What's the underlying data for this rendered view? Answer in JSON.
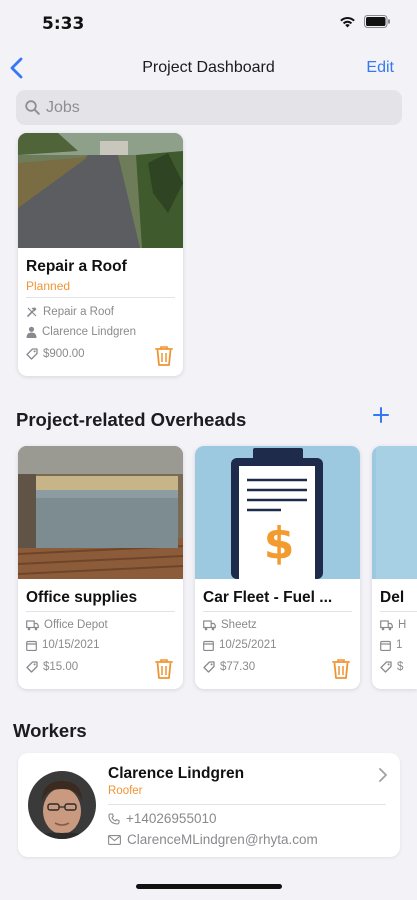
{
  "status_bar": {
    "time": "5:33"
  },
  "nav": {
    "title": "Project Dashboard",
    "edit_label": "Edit"
  },
  "search": {
    "placeholder": "Jobs"
  },
  "jobs": [
    {
      "title": "Repair a Roof",
      "status": "Planned",
      "task": "Repair a Roof",
      "worker": "Clarence  Lindgren",
      "amount": "$900.00"
    }
  ],
  "overheads_section": {
    "title": "Project-related Overheads"
  },
  "overheads": [
    {
      "title": "Office supplies",
      "vendor": "Office Depot",
      "date": "10/15/2021",
      "amount": "$15.00"
    },
    {
      "title": "Car Fleet  - Fuel ...",
      "vendor": "Sheetz",
      "date": "10/25/2021",
      "amount": "$77.30"
    },
    {
      "title": "Del",
      "vendor": "H",
      "date": "1",
      "amount": "$"
    }
  ],
  "workers_section": {
    "title": "Workers"
  },
  "workers": [
    {
      "name": "Clarence  Lindgren",
      "role": "Roofer",
      "phone": "+14026955010",
      "email": "ClarenceMLindgren@rhyta.com"
    }
  ],
  "colors": {
    "accent": "#3478f6",
    "orange": "#f09433",
    "background": "#f2f2f7"
  },
  "icons": [
    "chevron-left-icon",
    "search-icon",
    "hammer-icon",
    "person-icon",
    "tag-icon",
    "trash-icon",
    "truck-icon",
    "calendar-icon",
    "plus-icon",
    "chevron-right-icon",
    "phone-icon",
    "envelope-icon"
  ]
}
